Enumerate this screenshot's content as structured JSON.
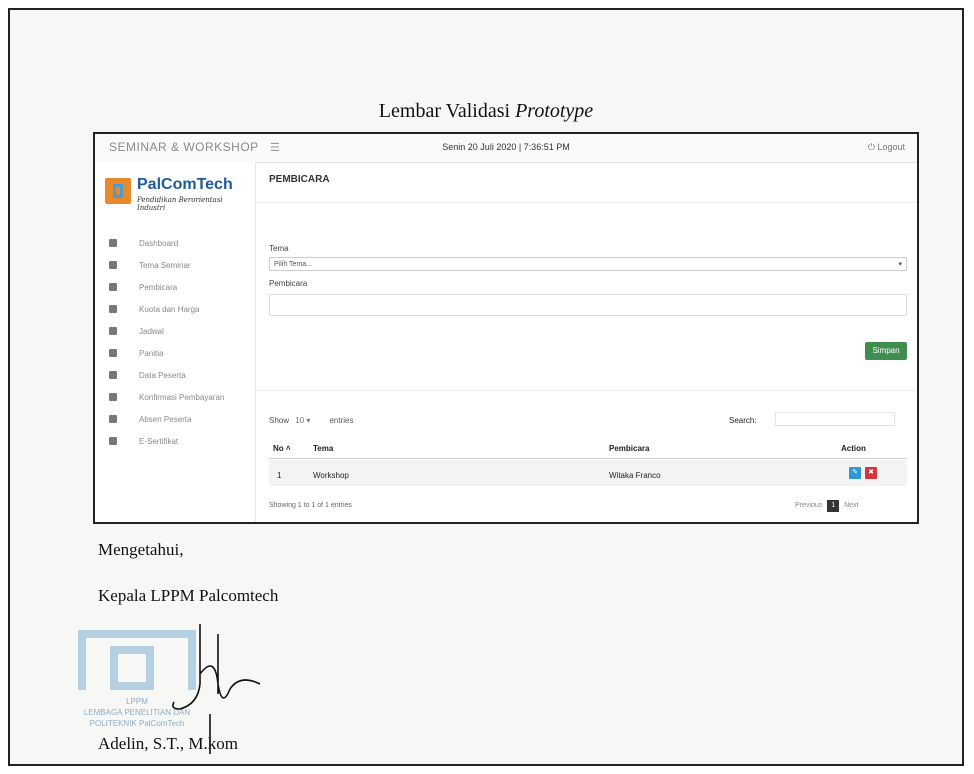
{
  "document": {
    "title_main": "Lembar Validasi ",
    "title_italic": "Prototype"
  },
  "app": {
    "brand": "SEMINAR & WORKSHOP",
    "datetime": "Senin 20 Juli 2020 | 7:36:51 PM",
    "logout": "Logout",
    "logo_name": "PalComTech",
    "logo_tagline": "Pendidikan Berorientasi Industri"
  },
  "sidebar": {
    "items": [
      {
        "label": "Dashboard"
      },
      {
        "label": "Tema Seminar"
      },
      {
        "label": "Pembicara"
      },
      {
        "label": "Kuota dan Harga"
      },
      {
        "label": "Jadwal"
      },
      {
        "label": "Panitia"
      },
      {
        "label": "Data Peserta"
      },
      {
        "label": "Konfirmasi Pembayaran"
      },
      {
        "label": "Absen Peserta"
      },
      {
        "label": "E-Sertifikat"
      }
    ]
  },
  "form": {
    "heading": "PEMBICARA",
    "tema_label": "Tema",
    "tema_value": "Pilih Tema...",
    "pembicara_label": "Pembicara",
    "save_label": "Simpan"
  },
  "table": {
    "show_label": "Show",
    "show_value": "10",
    "entries_label": "entries",
    "search_label": "Search:",
    "headers": {
      "no": "No",
      "tema": "Tema",
      "pembicara": "Pembicara",
      "action": "Action"
    },
    "rows": [
      {
        "no": "1",
        "tema": "Workshop",
        "pembicara": "Witaka Franco"
      }
    ],
    "showing": "Showing 1 to 1 of 1 entries",
    "previous": "Previous",
    "page": "1",
    "next": "Next"
  },
  "signature": {
    "known": "Mengetahui,",
    "position": "Kepala LPPM Palcomtech",
    "name": "Adelin, S.T., M.kom",
    "stamp_lines": [
      "LPPM",
      "LEMBAGA PENELITIAN DAN",
      "POLITEKNIK PalComTech"
    ]
  }
}
